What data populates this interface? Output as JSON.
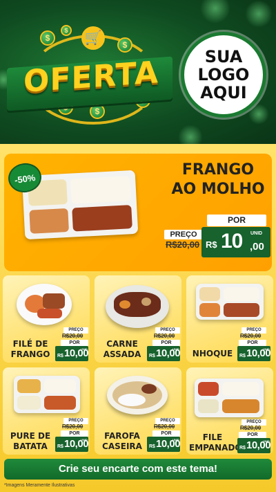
{
  "banner": {
    "headline": "OFERTA",
    "logo_lines": [
      "SUA",
      "LOGO",
      "AQUI"
    ],
    "currency_symbol": "$"
  },
  "featured": {
    "badge": "-50%",
    "title_line1": "FRANGO",
    "title_line2": "AO MOLHO",
    "preco_label": "PREÇO",
    "old_price": "R$20,00",
    "por_label": "POR",
    "unid_label": "UNID",
    "currency": "R$",
    "price_int": "10",
    "price_cents": ",00"
  },
  "products": [
    {
      "name_line1": "FILÉ DE",
      "name_line2": "FRANGO",
      "preco_label": "PREÇO",
      "old_price": "R$20,00",
      "por_label": "POR",
      "currency": "R$",
      "price": "10,00",
      "unid_label": "UNID"
    },
    {
      "name_line1": "CARNE",
      "name_line2": "ASSADA",
      "preco_label": "PREÇO",
      "old_price": "R$20,00",
      "por_label": "POR",
      "currency": "R$",
      "price": "10,00",
      "unid_label": "UNID"
    },
    {
      "name_line1": "NHOQUE",
      "name_line2": "",
      "preco_label": "PREÇO",
      "old_price": "R$20,00",
      "por_label": "POR",
      "currency": "R$",
      "price": "10,00",
      "unid_label": "UNID"
    },
    {
      "name_line1": "PURE DE",
      "name_line2": "BATATA",
      "preco_label": "PREÇO",
      "old_price": "R$20,00",
      "por_label": "POR",
      "currency": "R$",
      "price": "10,00",
      "unid_label": "UNID"
    },
    {
      "name_line1": "FAROFA",
      "name_line2": "CASEIRA",
      "preco_label": "PREÇO",
      "old_price": "R$20,00",
      "por_label": "POR",
      "currency": "R$",
      "price": "10,00",
      "unid_label": "UNID"
    },
    {
      "name_line1": "FILE",
      "name_line2": "EMPANADO",
      "preco_label": "PREÇO",
      "old_price": "R$20,00",
      "por_label": "POR",
      "currency": "R$",
      "price": "10,00",
      "unid_label": "UNID"
    }
  ],
  "cta": {
    "label": "Crie seu encarte com este tema!"
  },
  "footer": {
    "note": "*Imagens Meramente Ilustrativas"
  },
  "colors": {
    "brand_green": "#17622d",
    "accent_yellow": "#ffd21f",
    "card_orange": "#ffa000"
  }
}
